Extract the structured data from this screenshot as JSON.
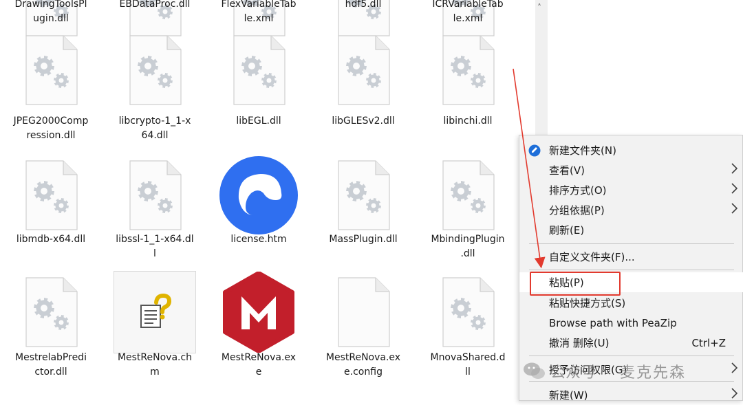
{
  "files": [
    {
      "name": "DrawingToolsPl\nugin.dll",
      "icon": "gear-file-icon"
    },
    {
      "name": "EBDataProc.dll",
      "icon": "gear-file-icon"
    },
    {
      "name": "FlexVariableTab\nle.xml",
      "icon": "gear-file-icon"
    },
    {
      "name": "hdf5.dll",
      "icon": "gear-file-icon"
    },
    {
      "name": "ICRVariableTab\nle.xml",
      "icon": "gear-file-icon"
    },
    {
      "name": "JPEG2000Comp\nression.dll",
      "icon": "gear-file-icon"
    },
    {
      "name": "libcrypto-1_1-x\n64.dll",
      "icon": "gear-file-icon"
    },
    {
      "name": "libEGL.dll",
      "icon": "gear-file-icon"
    },
    {
      "name": "libGLESv2.dll",
      "icon": "gear-file-icon"
    },
    {
      "name": "libinchi.dll",
      "icon": "gear-file-icon"
    },
    {
      "name": "libmdb-x64.dll",
      "icon": "gear-file-icon"
    },
    {
      "name": "libssl-1_1-x64.dl\nl",
      "icon": "gear-file-icon"
    },
    {
      "name": "license.htm",
      "icon": "browser-icon"
    },
    {
      "name": "MassPlugin.dll",
      "icon": "gear-file-icon"
    },
    {
      "name": "MbindingPlugin\n.dll",
      "icon": "gear-file-icon"
    },
    {
      "name": "MestrelabPredi\nctor.dll",
      "icon": "gear-file-icon"
    },
    {
      "name": "MestReNova.ch\nm",
      "icon": "help-file-icon"
    },
    {
      "name": "MestReNova.ex\ne",
      "icon": "mnova-app-icon"
    },
    {
      "name": "MestReNova.ex\ne.config",
      "icon": "blank-file-icon"
    },
    {
      "name": "MnovaShared.d\nll",
      "icon": "gear-file-icon"
    }
  ],
  "context_menu": {
    "items": [
      {
        "label": "新建文件夹(N)",
        "icon": "new-folder-icon"
      },
      {
        "label": "查看(V)",
        "submenu": true
      },
      {
        "label": "排序方式(O)",
        "submenu": true
      },
      {
        "label": "分组依据(P)",
        "submenu": true
      },
      {
        "label": "刷新(E)"
      },
      {
        "label": "自定义文件夹(F)..."
      },
      {
        "label": "粘贴(P)"
      },
      {
        "label": "粘贴快捷方式(S)"
      },
      {
        "label": "Browse path with PeaZip"
      },
      {
        "label": "撤消 删除(U)",
        "shortcut": "Ctrl+Z"
      },
      {
        "label": "授予访问权限(G)",
        "submenu": true
      },
      {
        "label": "新建(W)",
        "submenu": true
      }
    ]
  },
  "scrollbar": {
    "up_glyph": "˄"
  },
  "watermark": {
    "prefix": "公众号",
    "dot": "·",
    "name": "麦克先森"
  },
  "colors": {
    "highlight": "#e23a2e",
    "menu_bg": "#f2f2f2",
    "browser_blue": "#2f6ff0",
    "mnova_red": "#c21f2b"
  }
}
